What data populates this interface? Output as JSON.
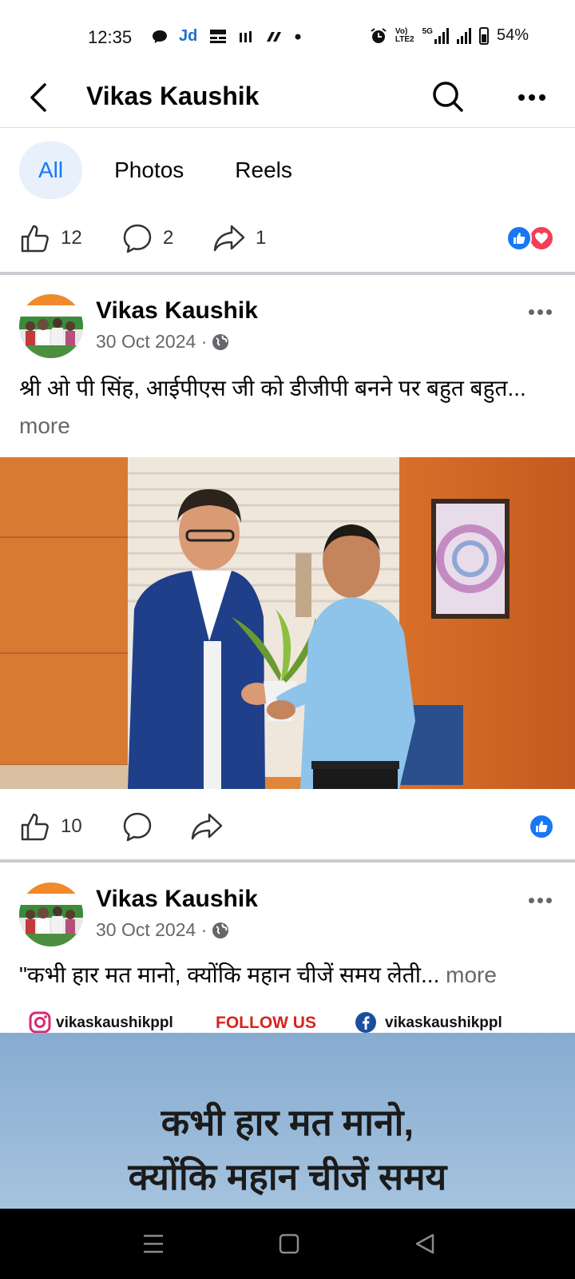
{
  "status_bar": {
    "time": "12:35",
    "notif_jd": "Jd",
    "volte_top": "Vo)",
    "volte_bottom": "LTE2",
    "net": "5G",
    "battery": "54%"
  },
  "header": {
    "title": "Vikas Kaushik"
  },
  "filters": {
    "all": "All",
    "photos": "Photos",
    "reels": "Reels"
  },
  "top_reactions": {
    "likes": "12",
    "comments": "2",
    "shares": "1"
  },
  "posts": [
    {
      "author": "Vikas Kaushik",
      "date": "30 Oct 2024 ·",
      "text": "श्री ओ पी सिंह, आईपीएस जी को डीजीपी बनने पर बहुत बहुत...",
      "more": "more",
      "likes": "10"
    },
    {
      "author": "Vikas Kaushik",
      "date": "30 Oct 2024 ·",
      "text": "\"कभी हार मत मानो, क्योंकि महान चीजें समय लेती...",
      "more": "more",
      "poster": {
        "instagram_handle": "vikaskaushikppl",
        "follow": "FOLLOW US",
        "facebook_handle": "vikaskaushikppl",
        "line1": "कभी हार मत मानो,",
        "line2": "क्योंकि महान चीजें समय"
      }
    }
  ],
  "colors": {
    "accent": "#1877f2",
    "love": "#f33e58",
    "chip_bg": "#e7f0fb",
    "follow_red": "#d6251d"
  }
}
